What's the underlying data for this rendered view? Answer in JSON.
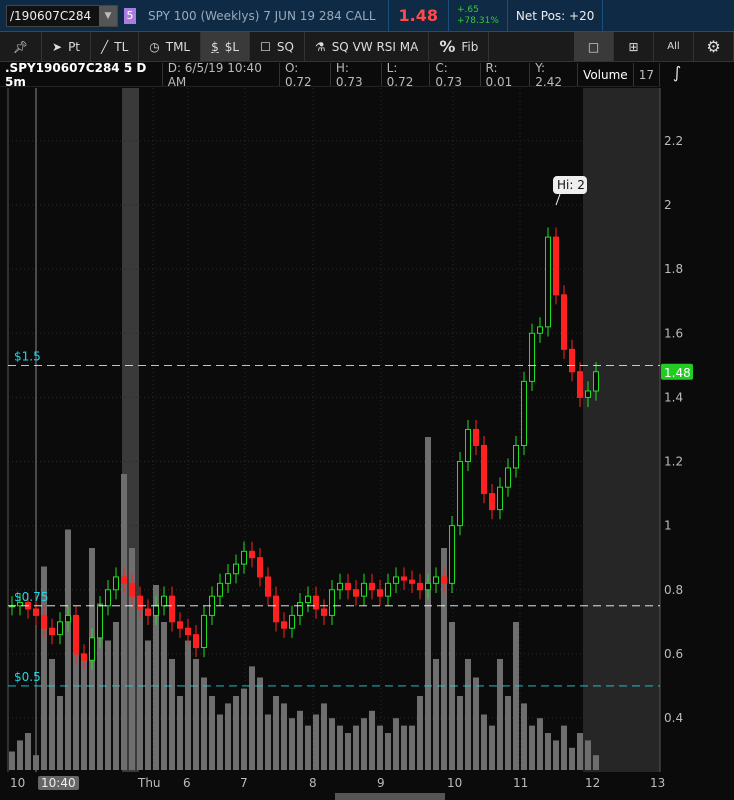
{
  "header": {
    "symbol": "/190607C284",
    "link_badge": "5",
    "description": "SPY 100 (Weeklys) 7 JUN 19 284 CALL",
    "last": "1.48",
    "change": "+.65",
    "change_pct": "+78.31%",
    "net_pos": "Net Pos: +20"
  },
  "toolbar": {
    "pin": "pin-icon",
    "pt": "Pt",
    "tl": "TL",
    "tml": "TML",
    "dl": "$L",
    "sq": "SQ",
    "studies": "SQ VW RSI MA",
    "fib": "Fib",
    "fib_icon": "%",
    "all": "All"
  },
  "info": {
    "symbol": ".SPY190607C284 5 D 5m",
    "date": "D: 6/5/19 10:40 AM",
    "open": "O: 0.72",
    "high": "H: 0.73",
    "low": "L: 0.72",
    "close": "C: 0.73",
    "range": "R: 0.01",
    "y": "Y: 2.42",
    "volume_label": "Volume",
    "volume": "17"
  },
  "chart_data": {
    "type": "candlestick",
    "ylim": [
      0.25,
      2.35
    ],
    "yticks": [
      "2.2",
      "2",
      "1.8",
      "1.6",
      "1.4",
      "1.2",
      "1",
      "0.8",
      "0.6",
      "0.4"
    ],
    "ytick_values": [
      2.2,
      2.0,
      1.8,
      1.6,
      1.4,
      1.2,
      1.0,
      0.8,
      0.6,
      0.4
    ],
    "xticks": [
      "10",
      "10:40",
      "Thu",
      "6",
      "7",
      "8",
      "9",
      "10",
      "11",
      "12",
      "13"
    ],
    "price_lines": [
      {
        "label": "$1.5",
        "value": 1.5,
        "color": "#ffffff"
      },
      {
        "label": "$0.75",
        "value": 0.75,
        "color": "#ffffff"
      },
      {
        "label": "$0.5",
        "value": 0.5,
        "color": "#22d3e0"
      }
    ],
    "last_price": {
      "label": "1.48",
      "value": 1.48
    },
    "high_bubble": {
      "label": "Hi: 2",
      "value": 2.0
    },
    "closes": [
      0.75,
      0.76,
      0.74,
      0.72,
      0.68,
      0.66,
      0.7,
      0.72,
      0.6,
      0.58,
      0.65,
      0.75,
      0.8,
      0.84,
      0.82,
      0.78,
      0.74,
      0.72,
      0.75,
      0.78,
      0.7,
      0.68,
      0.66,
      0.62,
      0.72,
      0.78,
      0.82,
      0.85,
      0.88,
      0.92,
      0.9,
      0.84,
      0.78,
      0.7,
      0.68,
      0.72,
      0.76,
      0.78,
      0.74,
      0.72,
      0.8,
      0.82,
      0.8,
      0.78,
      0.82,
      0.8,
      0.78,
      0.82,
      0.84,
      0.83,
      0.82,
      0.8,
      0.82,
      0.84,
      0.82,
      1.0,
      1.2,
      1.3,
      1.25,
      1.1,
      1.05,
      1.12,
      1.18,
      1.25,
      1.45,
      1.6,
      1.62,
      1.9,
      1.72,
      1.55,
      1.48,
      1.4,
      1.42,
      1.48
    ],
    "volumes": [
      5,
      8,
      10,
      4,
      55,
      30,
      20,
      65,
      40,
      30,
      60,
      45,
      35,
      40,
      80,
      60,
      45,
      35,
      50,
      40,
      30,
      20,
      35,
      30,
      25,
      20,
      15,
      18,
      20,
      22,
      28,
      25,
      15,
      20,
      18,
      14,
      16,
      12,
      15,
      18,
      14,
      12,
      10,
      12,
      14,
      16,
      12,
      10,
      14,
      12,
      12,
      20,
      90,
      30,
      60,
      40,
      20,
      30,
      25,
      15,
      12,
      30,
      20,
      40,
      18,
      12,
      14,
      10,
      8,
      12,
      6,
      10,
      8,
      4
    ]
  }
}
